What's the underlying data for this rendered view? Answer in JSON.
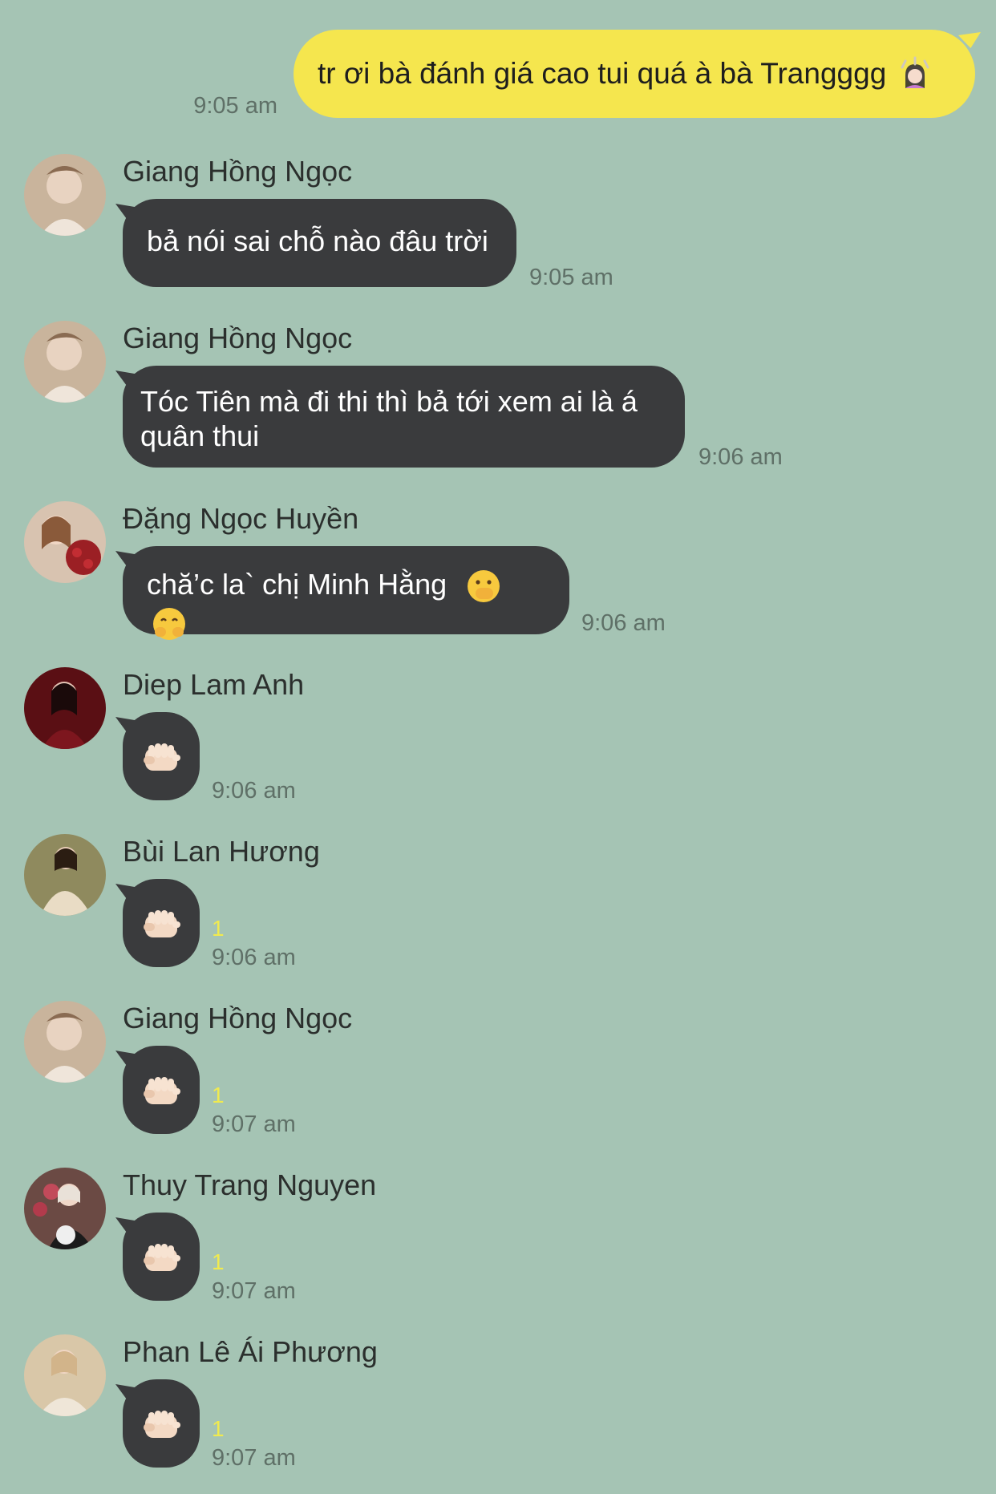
{
  "outgoing": {
    "text": "tr ơi bà đánh giá cao tui quá à bà Trangggg",
    "emoji_icon": "woman-gesturing-ok-icon",
    "time": "9:05 am"
  },
  "messages": [
    {
      "sender": "Giang Hồng Ngọc",
      "text": "bả nói sai chỗ nào đâu trời",
      "time": "9:05 am",
      "read": ""
    },
    {
      "sender": "Giang Hồng Ngọc",
      "text": "Tóc Tiên mà đi thi thì bả tới xem ai là á quân thui",
      "time": "9:06 am",
      "read": ""
    },
    {
      "sender": "Đặng Ngọc Huyền",
      "text": "chă’c la` chị Minh Hằng",
      "emoji_icons": [
        "face-with-hand-over-mouth-icon",
        "hugging-face-icon"
      ],
      "time": "9:06 am",
      "read": ""
    },
    {
      "sender": "Diep Lam Anh",
      "sticker_icon": "pointing-hand-icon",
      "time": "9:06 am",
      "read": ""
    },
    {
      "sender": "Bùi Lan Hương",
      "sticker_icon": "pointing-hand-icon",
      "time": "9:06 am",
      "read": "1"
    },
    {
      "sender": "Giang Hồng Ngọc",
      "sticker_icon": "pointing-hand-icon",
      "time": "9:07 am",
      "read": "1"
    },
    {
      "sender": "Thuy Trang Nguyen",
      "sticker_icon": "pointing-hand-icon",
      "time": "9:07 am",
      "read": "1"
    },
    {
      "sender": "Phan Lê Ái Phương",
      "sticker_icon": "pointing-hand-icon",
      "time": "9:07 am",
      "read": "1"
    }
  ],
  "colors": {
    "background": "#a5c4b4",
    "outgoing_bubble": "#f5e64e",
    "incoming_bubble": "#3a3b3d",
    "timestamp": "#5f7067",
    "read_count": "#f0ea4f"
  }
}
